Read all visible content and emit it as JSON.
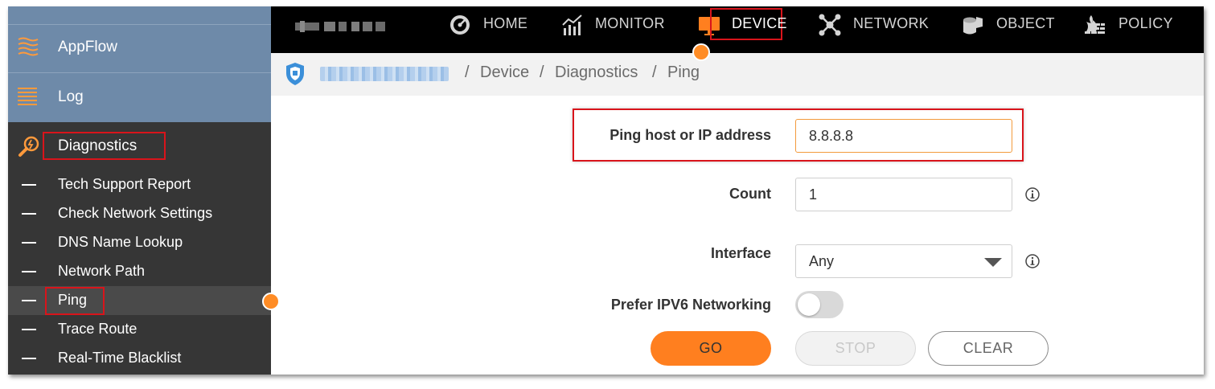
{
  "sidebar": {
    "appflow_label": "AppFlow",
    "log_label": "Log",
    "diagnostics_label": "Diagnostics",
    "items": [
      {
        "label": "Tech Support Report"
      },
      {
        "label": "Check Network Settings"
      },
      {
        "label": "DNS Name Lookup"
      },
      {
        "label": "Network Path"
      },
      {
        "label": "Ping"
      },
      {
        "label": "Trace Route"
      },
      {
        "label": "Real-Time Blacklist"
      }
    ],
    "active_item": "Ping"
  },
  "topnav": {
    "items": [
      {
        "label": "HOME",
        "icon": "dashboard-gauge-icon"
      },
      {
        "label": "MONITOR",
        "icon": "chart-trend-icon"
      },
      {
        "label": "DEVICE",
        "icon": "monitor-icon"
      },
      {
        "label": "NETWORK",
        "icon": "network-hub-icon"
      },
      {
        "label": "OBJECT",
        "icon": "cylinder-cube-icon"
      },
      {
        "label": "POLICY",
        "icon": "firewall-flame-icon"
      }
    ],
    "active": "DEVICE"
  },
  "breadcrumb": {
    "sep": "/",
    "items": [
      "Device",
      "Diagnostics",
      "Ping"
    ]
  },
  "form": {
    "host_label": "Ping host or IP address",
    "host_value": "8.8.8.8",
    "count_label": "Count",
    "count_value": "1",
    "interface_label": "Interface",
    "interface_value": "Any",
    "ipv6_label": "Prefer IPV6 Networking",
    "ipv6_enabled": false
  },
  "buttons": {
    "go": "GO",
    "stop": "STOP",
    "clear": "CLEAR"
  },
  "colors": {
    "accent": "#ff7f1f",
    "highlight": "#d9141b",
    "sidebar_top": "#6e8aa9",
    "sidebar_dark": "#363636"
  }
}
